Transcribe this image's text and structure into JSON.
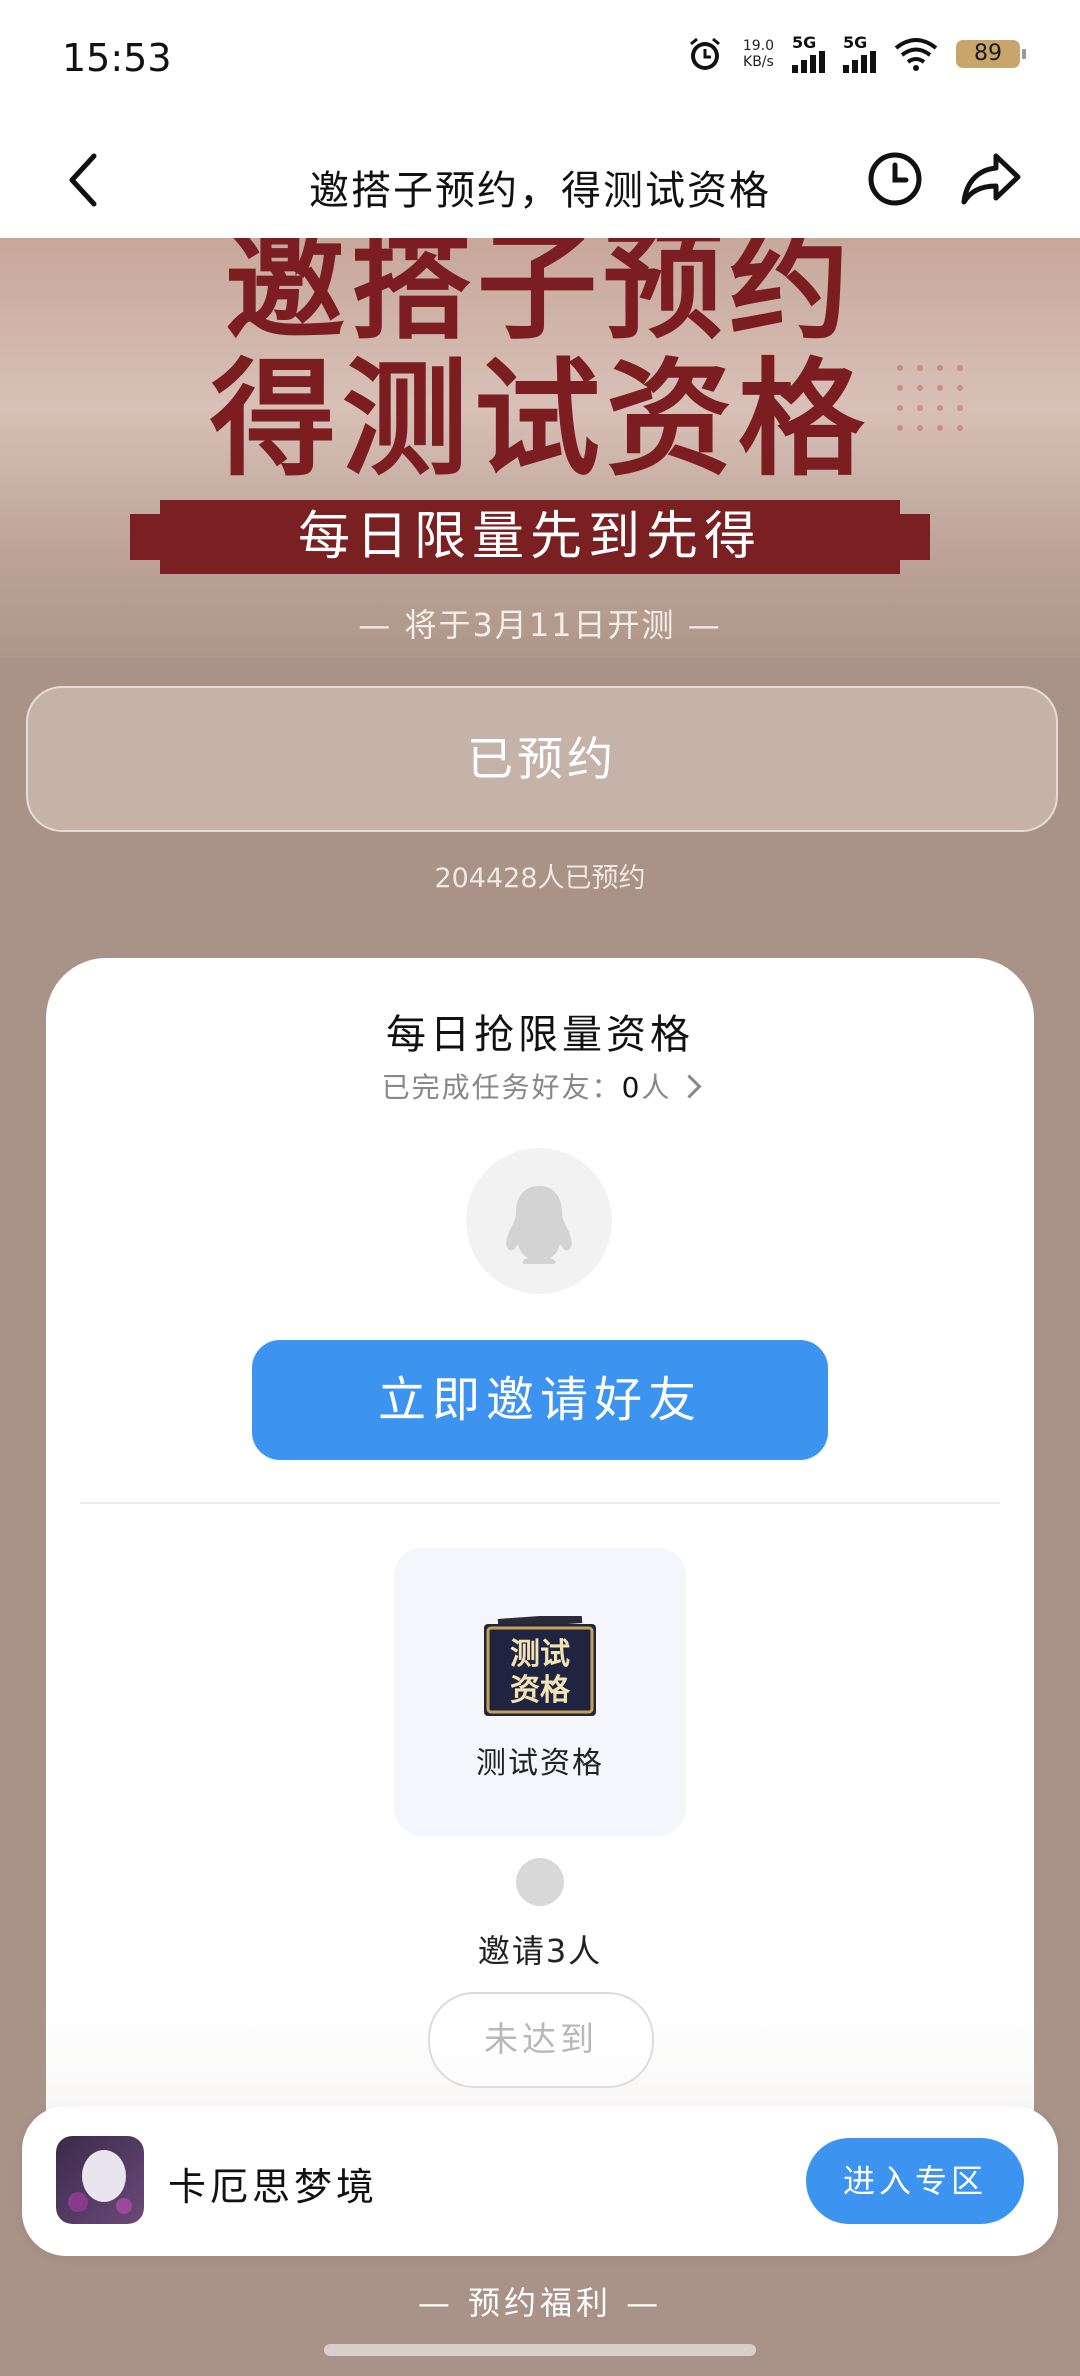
{
  "status_bar": {
    "time": "15:53",
    "net_speed_value": "19.0",
    "net_speed_unit": "KB/s",
    "sim1": "5G",
    "sim2": "5G",
    "battery": "89"
  },
  "nav": {
    "title": "邀搭子预约，得测试资格",
    "icons": [
      "back-icon",
      "history-clock-icon",
      "share-icon"
    ]
  },
  "banner": {
    "title_line1": "邀搭子预约",
    "title_line2": "得测试资格",
    "ribbon": "每日限量先到先得",
    "open_date": "— 将于3月11日开测 —"
  },
  "reserve": {
    "button_label": "已预约",
    "count_text": "204428人已预约"
  },
  "card": {
    "title": "每日抢限量资格",
    "friends_label": "已完成任务好友：",
    "friends_count": "0",
    "friends_unit": "人",
    "invite_button": "立即邀请好友",
    "reward": {
      "image_text": "测试资格",
      "name": "测试资格"
    },
    "milestone": {
      "label": "邀请3人",
      "status": "未达到"
    }
  },
  "game_bar": {
    "name": "卡厄思梦境",
    "enter_button": "进入专区"
  },
  "benefits_title": "— 预约福利 —",
  "colors": {
    "accent_blue": "#3d93f0",
    "banner_red": "#7c1d22",
    "page_bg": "#a99287"
  }
}
